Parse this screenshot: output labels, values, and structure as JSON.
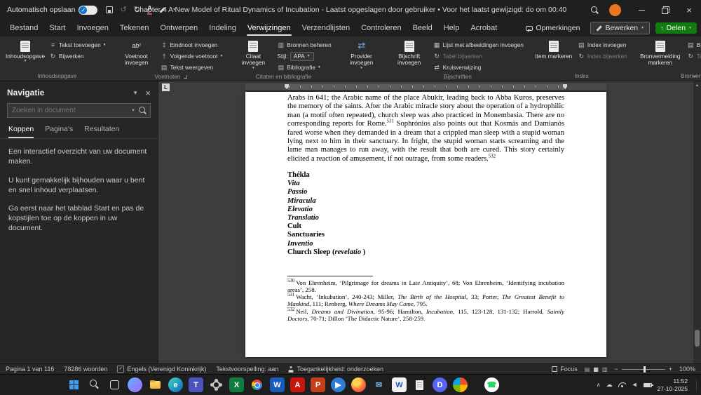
{
  "titlebar": {
    "autosave_label": "Automatisch opslaan",
    "title_full": "Chapter 4 A New Model of Ritual Dynamics of Incubation  -  Laatst opgeslagen door gebruiker • Voor het laatst gewijzigd: do om 00:40"
  },
  "menubar": {
    "tabs": [
      {
        "label": "Bestand",
        "active": false
      },
      {
        "label": "Start",
        "active": false
      },
      {
        "label": "Invoegen",
        "active": false
      },
      {
        "label": "Tekenen",
        "active": false
      },
      {
        "label": "Ontwerpen",
        "active": false
      },
      {
        "label": "Indeling",
        "active": false
      },
      {
        "label": "Verwijzingen",
        "active": true
      },
      {
        "label": "Verzendlijsten",
        "active": false
      },
      {
        "label": "Controleren",
        "active": false
      },
      {
        "label": "Beeld",
        "active": false
      },
      {
        "label": "Help",
        "active": false
      },
      {
        "label": "Acrobat",
        "active": false
      }
    ],
    "comments_label": "Opmerkingen",
    "editing_label": "Bewerken",
    "share_label": "Delen",
    "share_color": "#107c10"
  },
  "ribbon": {
    "toc": {
      "big": "Inhoudsopgave",
      "add_text": "Tekst toevoegen",
      "update": "Bijwerken",
      "group_label": "Inhoudsopgave"
    },
    "footnotes": {
      "big": "Voetnoot invoegen",
      "insert_endnote": "Eindnoot invoegen",
      "next_footnote": "Volgende voetnoot",
      "show_notes": "Tekst weergeven",
      "group_label": "Voetnoten"
    },
    "citations": {
      "big": "Citaat invoegen",
      "manage_sources": "Bronnen beheren",
      "style_label": "Stijl:",
      "style_value": "APA",
      "bibliography": "Bibliografie",
      "group_label": "Citaten en bibliografie"
    },
    "research": {
      "big": "Provider invoegen"
    },
    "captions": {
      "big": "Bijschrift invoegen",
      "table_of_figures": "Lijst met afbeeldingen invoegen",
      "update_table": "Tabel bijwerken",
      "cross_reference": "Kruisverwijzing",
      "group_label": "Bijschriften"
    },
    "index": {
      "big": "Item markeren",
      "insert_index": "Index invoegen",
      "update_index": "Index bijwerken",
      "group_label": "Index"
    },
    "authorities": {
      "big": "Bronvermelding markeren",
      "insert_citation": "Bronvermelding invoegen",
      "update_table": "Tabel bijwerken",
      "group_label": "Bronvermelding"
    }
  },
  "navigation": {
    "title": "Navigatie",
    "search_placeholder": "Zoeken in document",
    "tabs": [
      {
        "label": "Koppen",
        "active": true
      },
      {
        "label": "Pagina's",
        "active": false
      },
      {
        "label": "Resultaten",
        "active": false
      }
    ],
    "paragraphs": [
      "Een interactief overzicht van uw document maken.",
      "U kunt gemakkelijk bijhouden waar u bent en snel inhoud verplaatsen.",
      "Ga eerst naar het tabblad Start en pas de kopstijlen toe op de koppen in uw document."
    ]
  },
  "document": {
    "tab_selector": "L",
    "paragraph": {
      "part1": "Arabs in 641; the Arabic name of the place Abukir, leading back to Abba Kuros, preserves the memory of the saints. After the Arabic miracle story about the operation of a hydrophilic man (a motif often repeated), church sleep was also practiced in Monembasia. There are no corresponding reports for Rome.",
      "sup1": "531",
      "part2": " Sophrónios also points out that Kosmás and Damianós fared worse when they demanded in a dream that a crippled man sleep with a stupid woman lying next to him in their sanctuary. In fright, the stupid woman starts screaming and the lame man manages to run away, with the result that both are cured. This story certainly elicited a reaction of amusement, if not outrage, from some readers.",
      "sup2": "532"
    },
    "headings": [
      {
        "runs": [
          {
            "t": "Thékla"
          }
        ]
      },
      {
        "runs": [
          {
            "t": "Vita",
            "i": true
          }
        ]
      },
      {
        "runs": [
          {
            "t": "Passio",
            "i": true
          }
        ]
      },
      {
        "runs": [
          {
            "t": "Miracula",
            "i": true
          }
        ]
      },
      {
        "runs": [
          {
            "t": "Elevatio",
            "i": true
          }
        ]
      },
      {
        "runs": [
          {
            "t": "Translatio",
            "i": true
          }
        ]
      },
      {
        "runs": [
          {
            "t": "Cult"
          }
        ]
      },
      {
        "runs": [
          {
            "t": "Sanctuaries"
          }
        ]
      },
      {
        "runs": [
          {
            "t": "Inventio",
            "i": true
          }
        ]
      },
      {
        "runs": [
          {
            "t": "Church Sleep ("
          },
          {
            "t": "revelatio",
            "i": true
          },
          {
            "t": " )"
          }
        ]
      }
    ],
    "footnotes": [
      {
        "num": "530",
        "runs": [
          {
            "t": "Von Ehrenheim, ‘Pilgrimage for dreams in Late Antiquity’, 68; Von Ehrenheim, ‘Identifying incubation areas’, 258."
          }
        ]
      },
      {
        "num": "531",
        "runs": [
          {
            "t": "Wacht, ‘Inkubation’, 240-243; Miller, "
          },
          {
            "t": "The Birth of the Hospital",
            "i": true
          },
          {
            "t": ", 33; Porter, "
          },
          {
            "t": "The Greatest Benefit to Mankind",
            "i": true
          },
          {
            "t": ", 111; Renberg, "
          },
          {
            "t": "Where Dreams May Come",
            "i": true
          },
          {
            "t": ", 795."
          }
        ]
      },
      {
        "num": "532",
        "runs": [
          {
            "t": "Neil, "
          },
          {
            "t": "Dreams and Divination",
            "i": true
          },
          {
            "t": ", 95-96; Hamilton, "
          },
          {
            "t": "Incubation",
            "i": true
          },
          {
            "t": ", 115, 123-128, 131-132; Harrold, "
          },
          {
            "t": "Saintly Doctors",
            "i": true
          },
          {
            "t": ", 70-71; Dillon ‘The Didactic Nature’, 258-259."
          }
        ]
      }
    ]
  },
  "statusbar": {
    "page_info": "Pagina 1 van 116",
    "word_count": "78286 woorden",
    "language": "Engels (Verenigd Koninkrijk)",
    "text_prediction": "Tekstvoorspelling: aan",
    "accessibility": "Toegankelijkheid: onderzoeken",
    "focus_label": "Focus",
    "zoom_level": "100%"
  },
  "taskbar": {
    "time": "11:52",
    "date": "27-10-2025",
    "apps": [
      {
        "name": "start",
        "cls": "ic-start"
      },
      {
        "name": "search",
        "cls": "ic-tsearch"
      },
      {
        "name": "task-view",
        "cls": "ic-taskview"
      },
      {
        "name": "copilot",
        "shape": "circle",
        "bg": "linear-gradient(135deg,#62b0ff,#a06bff)"
      },
      {
        "name": "file-explorer",
        "cls": "ic-folder"
      },
      {
        "name": "edge",
        "shape": "circle",
        "bg": "linear-gradient(135deg,#45d6c2,#0a67c2)",
        "label": "e",
        "fg": "#ffffff"
      },
      {
        "name": "teams",
        "shape": "tile",
        "bg": "#4b53bc",
        "label": "T",
        "fg": "#ffffff"
      },
      {
        "name": "settings",
        "cls": "ic-gear"
      },
      {
        "name": "excel",
        "shape": "tile",
        "bg": "#107c41",
        "label": "X",
        "fg": "#ffffff"
      },
      {
        "name": "chrome",
        "cls": "ic-chrome"
      },
      {
        "name": "word",
        "shape": "tile",
        "bg": "#185abd",
        "label": "W",
        "fg": "#ffffff"
      },
      {
        "name": "acrobat",
        "shape": "tile",
        "bg": "#c9150b",
        "label": "A",
        "fg": "#ffffff"
      },
      {
        "name": "powerpoint",
        "shape": "tile",
        "bg": "#c43e1c",
        "label": "P",
        "fg": "#ffffff"
      },
      {
        "name": "media-player",
        "shape": "circle",
        "bg": "#2d7dd2",
        "label": "▶",
        "fg": "#ffffff"
      },
      {
        "name": "firefox",
        "shape": "circle",
        "bg": "radial-gradient(circle at 35% 30%,#ffd54f 0 25%,#ff7139 55%,#d6356f 100%)"
      },
      {
        "name": "mail",
        "shape": "tile",
        "bg": "transparent",
        "label": "✉",
        "fg": "#7cb9f2"
      },
      {
        "name": "word-document",
        "shape": "tile",
        "bg": "#f3f3f3",
        "label": "W",
        "fg": "#185abd"
      },
      {
        "name": "notepad",
        "cls": "ic-notepad"
      },
      {
        "name": "discord",
        "shape": "circle",
        "bg": "#5865f2",
        "label": "D",
        "fg": "#ffffff"
      },
      {
        "name": "photos",
        "shape": "circle",
        "bg": "conic-gradient(#f25022 0 25%,#ffb900 25% 50%,#7fba00 50% 75%,#00a4ef 75% 100%)"
      },
      {
        "name": "whatsapp",
        "shape": "circle",
        "bg": "#ffffff",
        "label": "☎",
        "fg": "#25d366",
        "gap": true
      }
    ]
  }
}
